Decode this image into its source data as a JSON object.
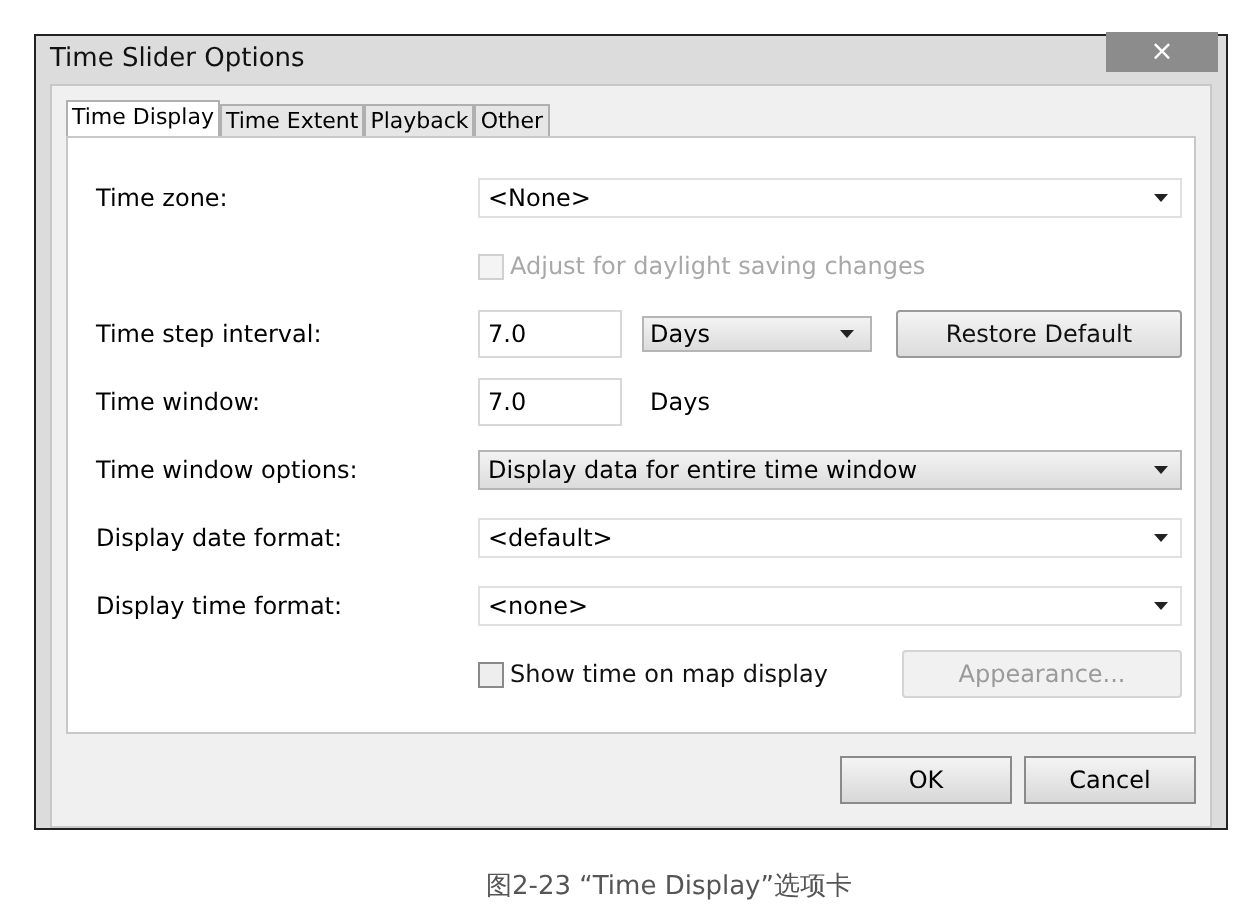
{
  "window": {
    "title": "Time Slider Options",
    "close": "×"
  },
  "tabs": [
    {
      "label": "Time Display",
      "selected": true
    },
    {
      "label": "Time Extent",
      "selected": false
    },
    {
      "label": "Playback",
      "selected": false
    },
    {
      "label": "Other",
      "selected": false
    }
  ],
  "rows": [
    {
      "kind": "dropdown",
      "label": "Time zone:",
      "value": "<None>",
      "editable": true
    },
    {
      "kind": "checkbox",
      "text": "Adjust for daylight saving changes",
      "checked": false,
      "disabled": true
    },
    {
      "kind": "interval",
      "label": "Time step interval:",
      "value": "7.0",
      "unit": "Days",
      "button": {
        "label": "Restore Default",
        "disabled": false
      }
    },
    {
      "kind": "value_unit",
      "label": "Time window:",
      "value": "7.0",
      "unit": "Days"
    },
    {
      "kind": "dropdown",
      "label": "Time window options:",
      "value": "Display data for entire time window",
      "editable": false
    },
    {
      "kind": "dropdown",
      "label": "Display date format:",
      "value": "<default>",
      "editable": true
    },
    {
      "kind": "dropdown",
      "label": "Display time format:",
      "value": "<none>",
      "editable": true
    },
    {
      "kind": "checkbox",
      "text": "Show time on map display",
      "checked": false,
      "disabled": false,
      "button": {
        "label": "Appearance...",
        "disabled": true
      }
    }
  ],
  "buttons": [
    "OK",
    "Cancel"
  ],
  "caption": "图2-23 “Time Display”选项卡"
}
